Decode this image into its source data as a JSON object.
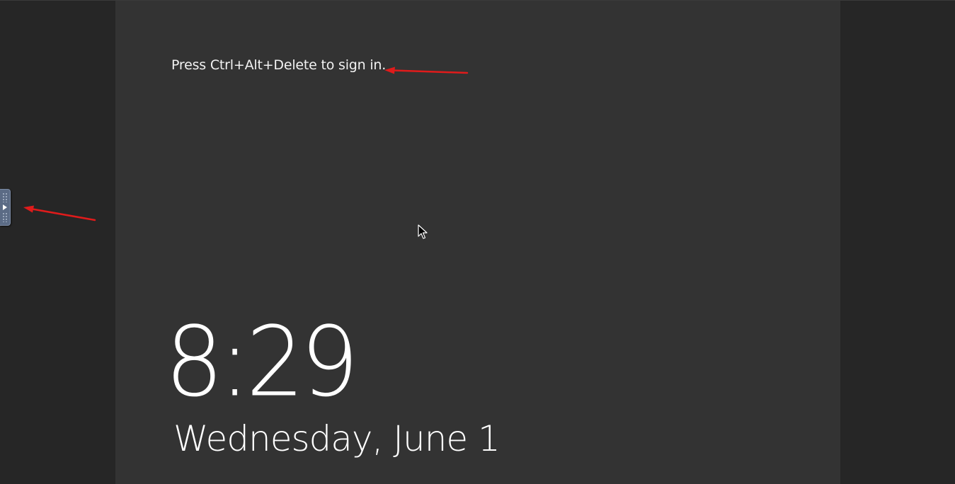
{
  "lock_screen": {
    "prompt": "Press Ctrl+Alt+Delete to sign in.",
    "time": "8:29",
    "date": "Wednesday, June 1"
  },
  "side_handle": {
    "icon": "play-triangle-icon"
  },
  "annotation_color": "#e01b1b",
  "panel_color": "#333333",
  "background_color": "#262626",
  "handle_color": "#5b6b85"
}
